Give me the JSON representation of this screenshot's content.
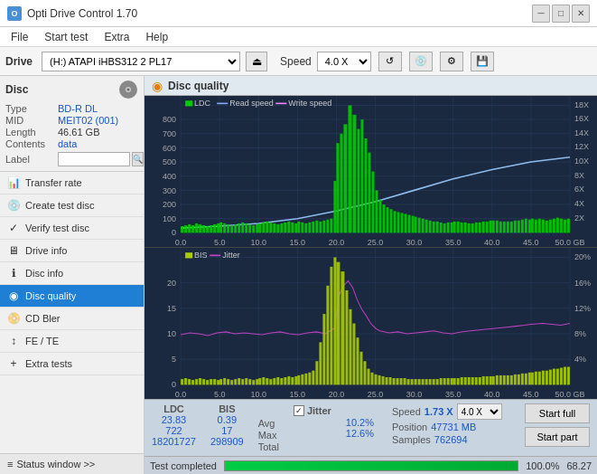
{
  "titleBar": {
    "title": "Opti Drive Control 1.70",
    "icon": "ODC",
    "controls": [
      "minimize",
      "maximize",
      "close"
    ]
  },
  "menuBar": {
    "items": [
      "File",
      "Start test",
      "Extra",
      "Help"
    ]
  },
  "driveBar": {
    "label": "Drive",
    "driveValue": "(H:) ATAPI iHBS312  2 PL17",
    "speedLabel": "Speed",
    "speedValue": "4.0 X"
  },
  "disc": {
    "title": "Disc",
    "typeLabel": "Type",
    "typeValue": "BD-R DL",
    "midLabel": "MID",
    "midValue": "MEIT02 (001)",
    "lengthLabel": "Length",
    "lengthValue": "46.61 GB",
    "contentsLabel": "Contents",
    "contentsValue": "data",
    "labelLabel": "Label",
    "labelValue": ""
  },
  "sidebar": {
    "items": [
      {
        "id": "transfer-rate",
        "label": "Transfer rate",
        "icon": "→"
      },
      {
        "id": "create-test-disc",
        "label": "Create test disc",
        "icon": "+"
      },
      {
        "id": "verify-test-disc",
        "label": "Verify test disc",
        "icon": "✓"
      },
      {
        "id": "drive-info",
        "label": "Drive info",
        "icon": "i"
      },
      {
        "id": "disc-info",
        "label": "Disc info",
        "icon": "d"
      },
      {
        "id": "disc-quality",
        "label": "Disc quality",
        "icon": "q",
        "active": true
      },
      {
        "id": "cd-bler",
        "label": "CD Bler",
        "icon": "c"
      },
      {
        "id": "fe-te",
        "label": "FE / TE",
        "icon": "f"
      },
      {
        "id": "extra-tests",
        "label": "Extra tests",
        "icon": "e"
      }
    ]
  },
  "statusWindow": {
    "label": "Status window >>",
    "icon": "≡"
  },
  "discQuality": {
    "title": "Disc quality",
    "chart1": {
      "legend": [
        "LDC",
        "Read speed",
        "Write speed"
      ],
      "yAxisMax": 800,
      "yAxisRight": 18,
      "xAxisMax": 50
    },
    "chart2": {
      "legend": [
        "BIS",
        "Jitter"
      ],
      "yAxisMax": 20,
      "yAxisRightMax": 20,
      "xAxisMax": 50
    }
  },
  "stats": {
    "colHeaders": [
      "LDC",
      "BIS",
      "",
      "Jitter",
      "Speed",
      "1.73 X",
      "",
      "4.0 X"
    ],
    "rows": [
      {
        "label": "Avg",
        "ldc": "23.83",
        "bis": "0.39",
        "jitter": "10.2%"
      },
      {
        "label": "Max",
        "ldc": "722",
        "bis": "17",
        "jitter": "12.6%",
        "positionLabel": "Position",
        "positionValue": "47731 MB"
      },
      {
        "label": "Total",
        "ldc": "18201727",
        "bis": "298909",
        "jitterLabel": "Samples",
        "jitterValue": "762694"
      }
    ],
    "jitterChecked": true,
    "speedLabel": "Speed",
    "speedValue": "1.73 X",
    "speedSelectValue": "4.0 X",
    "positionLabel": "Position",
    "positionValue": "47731 MB",
    "samplesLabel": "Samples",
    "samplesValue": "762694",
    "startFullBtn": "Start full",
    "startPartBtn": "Start part"
  },
  "progressBar": {
    "label": "Test completed",
    "percent": 100,
    "percentText": "100.0%",
    "rightText": "68.27"
  },
  "colors": {
    "chartBg": "#1e2d3d",
    "gridLine": "#2a4060",
    "ldc": "#00cc00",
    "bis": "#cccc00",
    "readSpeed": "#00aaff",
    "jitter": "#cc44cc",
    "accent": "#1e7fd4"
  }
}
